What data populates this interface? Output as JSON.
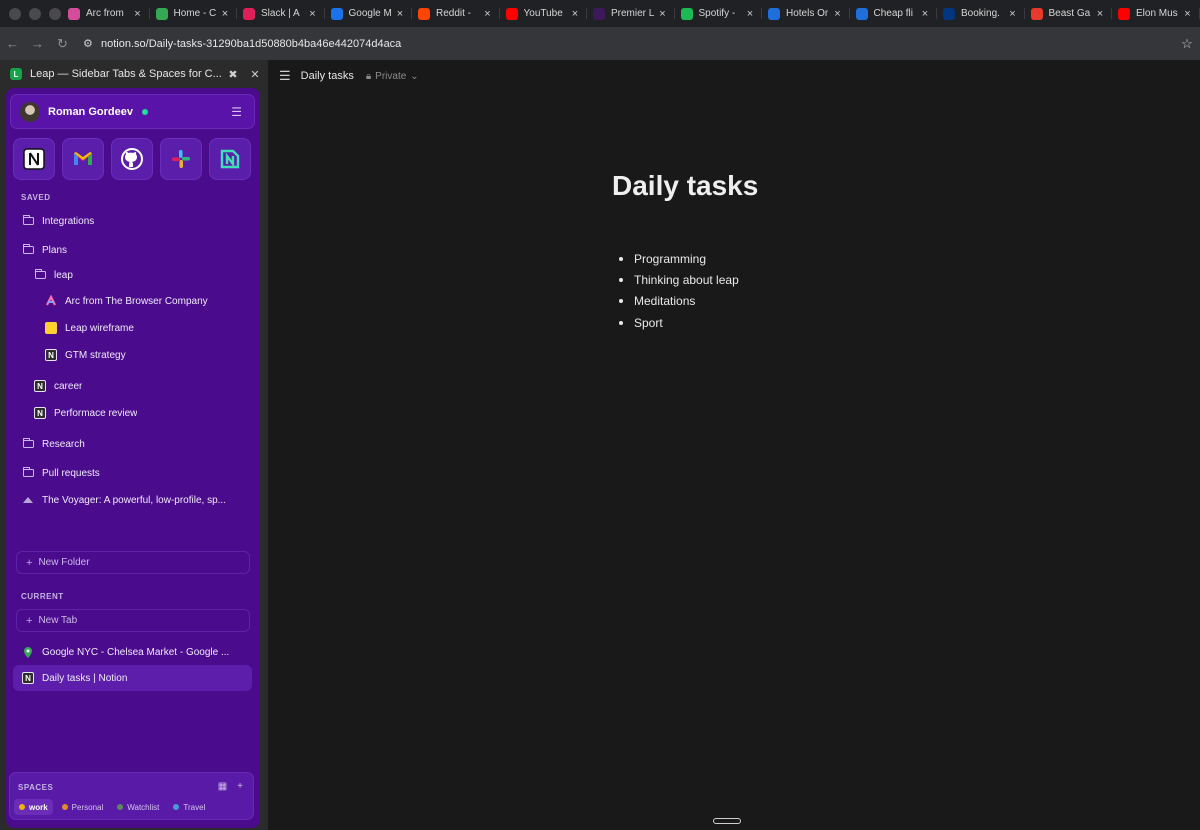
{
  "browser": {
    "tabs": [
      {
        "label": "Arc from",
        "icon": "arc-icon",
        "color": "#d64b9a"
      },
      {
        "label": "Home - C",
        "icon": "google-drive-icon",
        "color": "#34a853"
      },
      {
        "label": "Slack | A",
        "icon": "slack-icon",
        "color": "#e01e5a"
      },
      {
        "label": "Google M",
        "icon": "google-maps-icon",
        "color": "#1a73e8"
      },
      {
        "label": "Reddit -",
        "icon": "reddit-icon",
        "color": "#ff4500"
      },
      {
        "label": "YouTube",
        "icon": "youtube-icon",
        "color": "#ff0000"
      },
      {
        "label": "Premier L",
        "icon": "premier-league-icon",
        "color": "#3d185b"
      },
      {
        "label": "Spotify -",
        "icon": "spotify-icon",
        "color": "#1db954"
      },
      {
        "label": "Hotels Or",
        "icon": "hotels-icon",
        "color": "#1e6fd9"
      },
      {
        "label": "Cheap fli",
        "icon": "flights-icon",
        "color": "#1e6fd9"
      },
      {
        "label": "Booking.",
        "icon": "booking-icon",
        "color": "#003580"
      },
      {
        "label": "Beast Ga",
        "icon": "beast-games-icon",
        "color": "#e63a2e"
      },
      {
        "label": "Elon Mus",
        "icon": "youtube-icon",
        "color": "#ff0000"
      }
    ],
    "url": "notion.so/Daily-tasks-31290ba1d50880b4ba46e442074d4aca"
  },
  "extension": {
    "title": "Leap — Sidebar Tabs & Spaces for C...",
    "logo_letter": "L",
    "profile_name": "Roman Gordeev"
  },
  "sidebar": {
    "saved_label": "SAVED",
    "saved_items": [
      {
        "label": "Integrations",
        "type": "folder"
      },
      {
        "label": "Plans",
        "type": "folder"
      },
      {
        "label": "leap",
        "type": "folder"
      },
      {
        "label": "Arc from The Browser Company",
        "type": "arc"
      },
      {
        "label": "Leap wireframe",
        "type": "miro"
      },
      {
        "label": "GTM strategy",
        "type": "notion"
      },
      {
        "label": "career",
        "type": "notion"
      },
      {
        "label": "Performace review",
        "type": "notion"
      },
      {
        "label": "Research",
        "type": "folder"
      },
      {
        "label": "Pull requests",
        "type": "folder"
      },
      {
        "label": "The Voyager: A powerful, low-profile, sp...",
        "type": "keyboard"
      }
    ],
    "new_folder_label": "New Folder",
    "current_label": "CURRENT",
    "new_tab_label": "New Tab",
    "current_items": [
      {
        "label": "Google NYC - Chelsea Market - Google ...",
        "type": "maps"
      },
      {
        "label": "Daily tasks | Notion",
        "type": "notion"
      }
    ],
    "spaces_label": "SPACES",
    "spaces": [
      {
        "label": "work",
        "color": "#f0b400"
      },
      {
        "label": "Personal",
        "color": "#e08a2e"
      },
      {
        "label": "Watchlist",
        "color": "#5a8a5a"
      },
      {
        "label": "Travel",
        "color": "#4a9ad8"
      }
    ]
  },
  "page": {
    "breadcrumb": "Daily tasks",
    "privacy": "Private",
    "title": "Daily tasks",
    "bullets": [
      "Programming",
      "Thinking about leap",
      "Meditations",
      "Sport"
    ]
  }
}
